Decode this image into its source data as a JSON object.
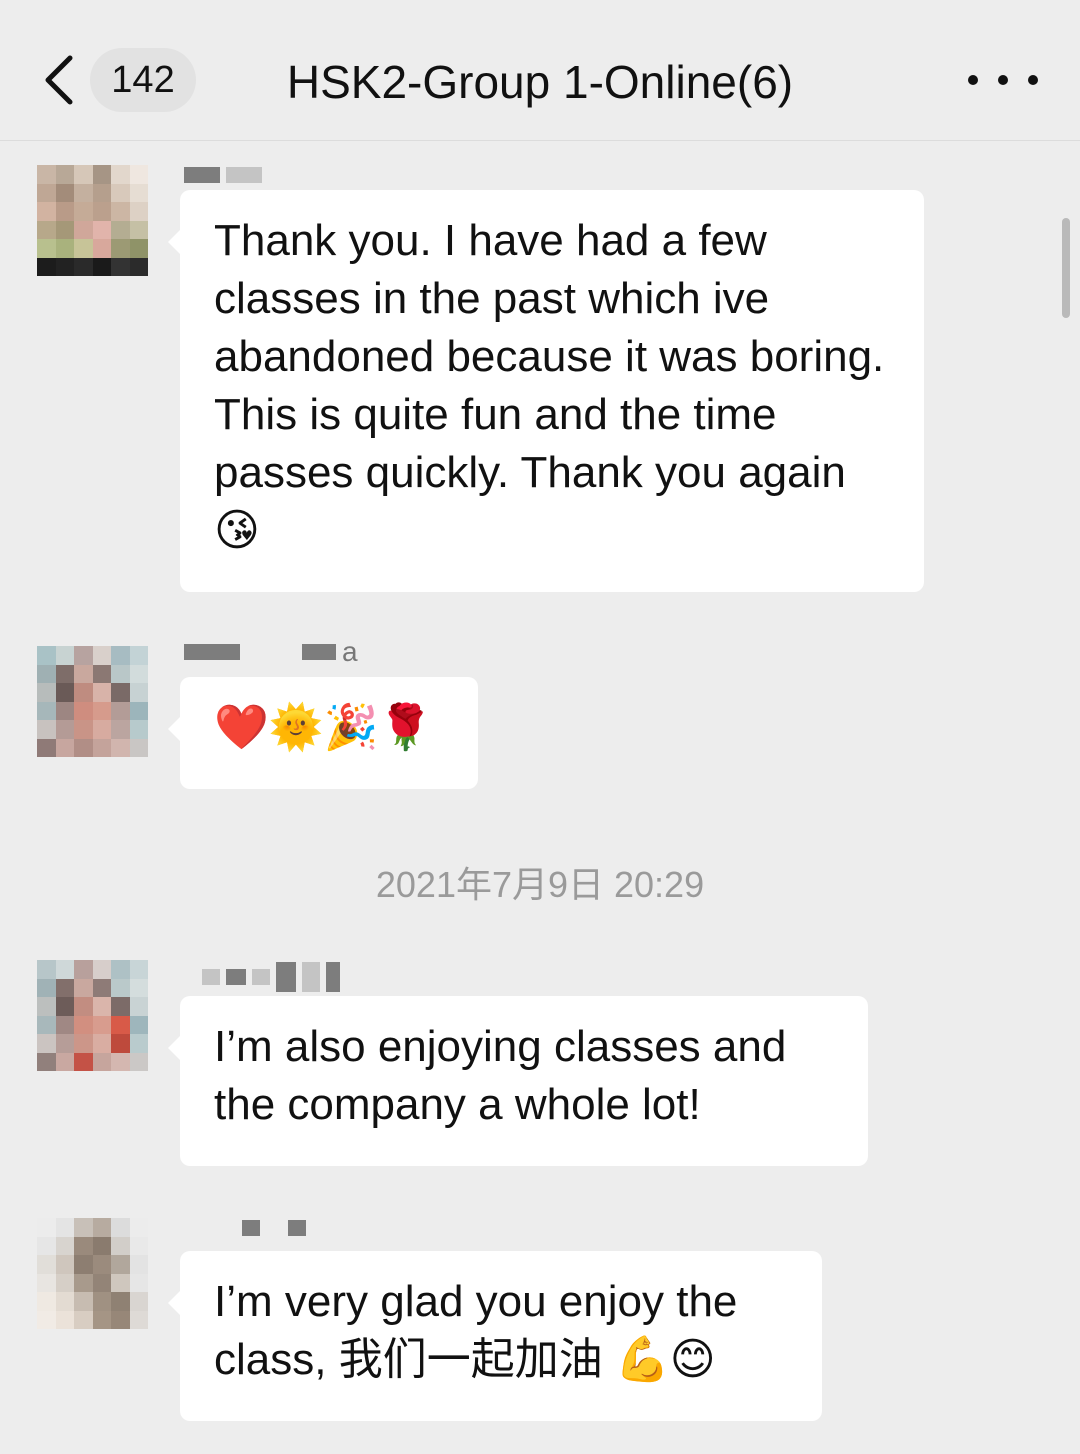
{
  "header": {
    "back_icon": "chevron-left-icon",
    "unread_count": "142",
    "title": "HSK2-Group 1-Online(6)",
    "more_icon": "more-dots-icon"
  },
  "messages": [
    {
      "sender_suffix": "",
      "text": "Thank you. I have had a few classes in the past which ive abandoned because it was boring. This is quite fun and the time passes quickly. Thank you again",
      "emoji": "😘"
    },
    {
      "sender_suffix": "a",
      "emoji": "❤️🌞🎉🌹"
    },
    {
      "sender_suffix": "",
      "text": "I’m also enjoying classes and the company a whole lot!"
    },
    {
      "sender_suffix": "",
      "text": "I’m very glad you enjoy the class, 我们一起加油",
      "emoji": "💪😊"
    }
  ],
  "timestamp": "2021年7月9日 20:29"
}
